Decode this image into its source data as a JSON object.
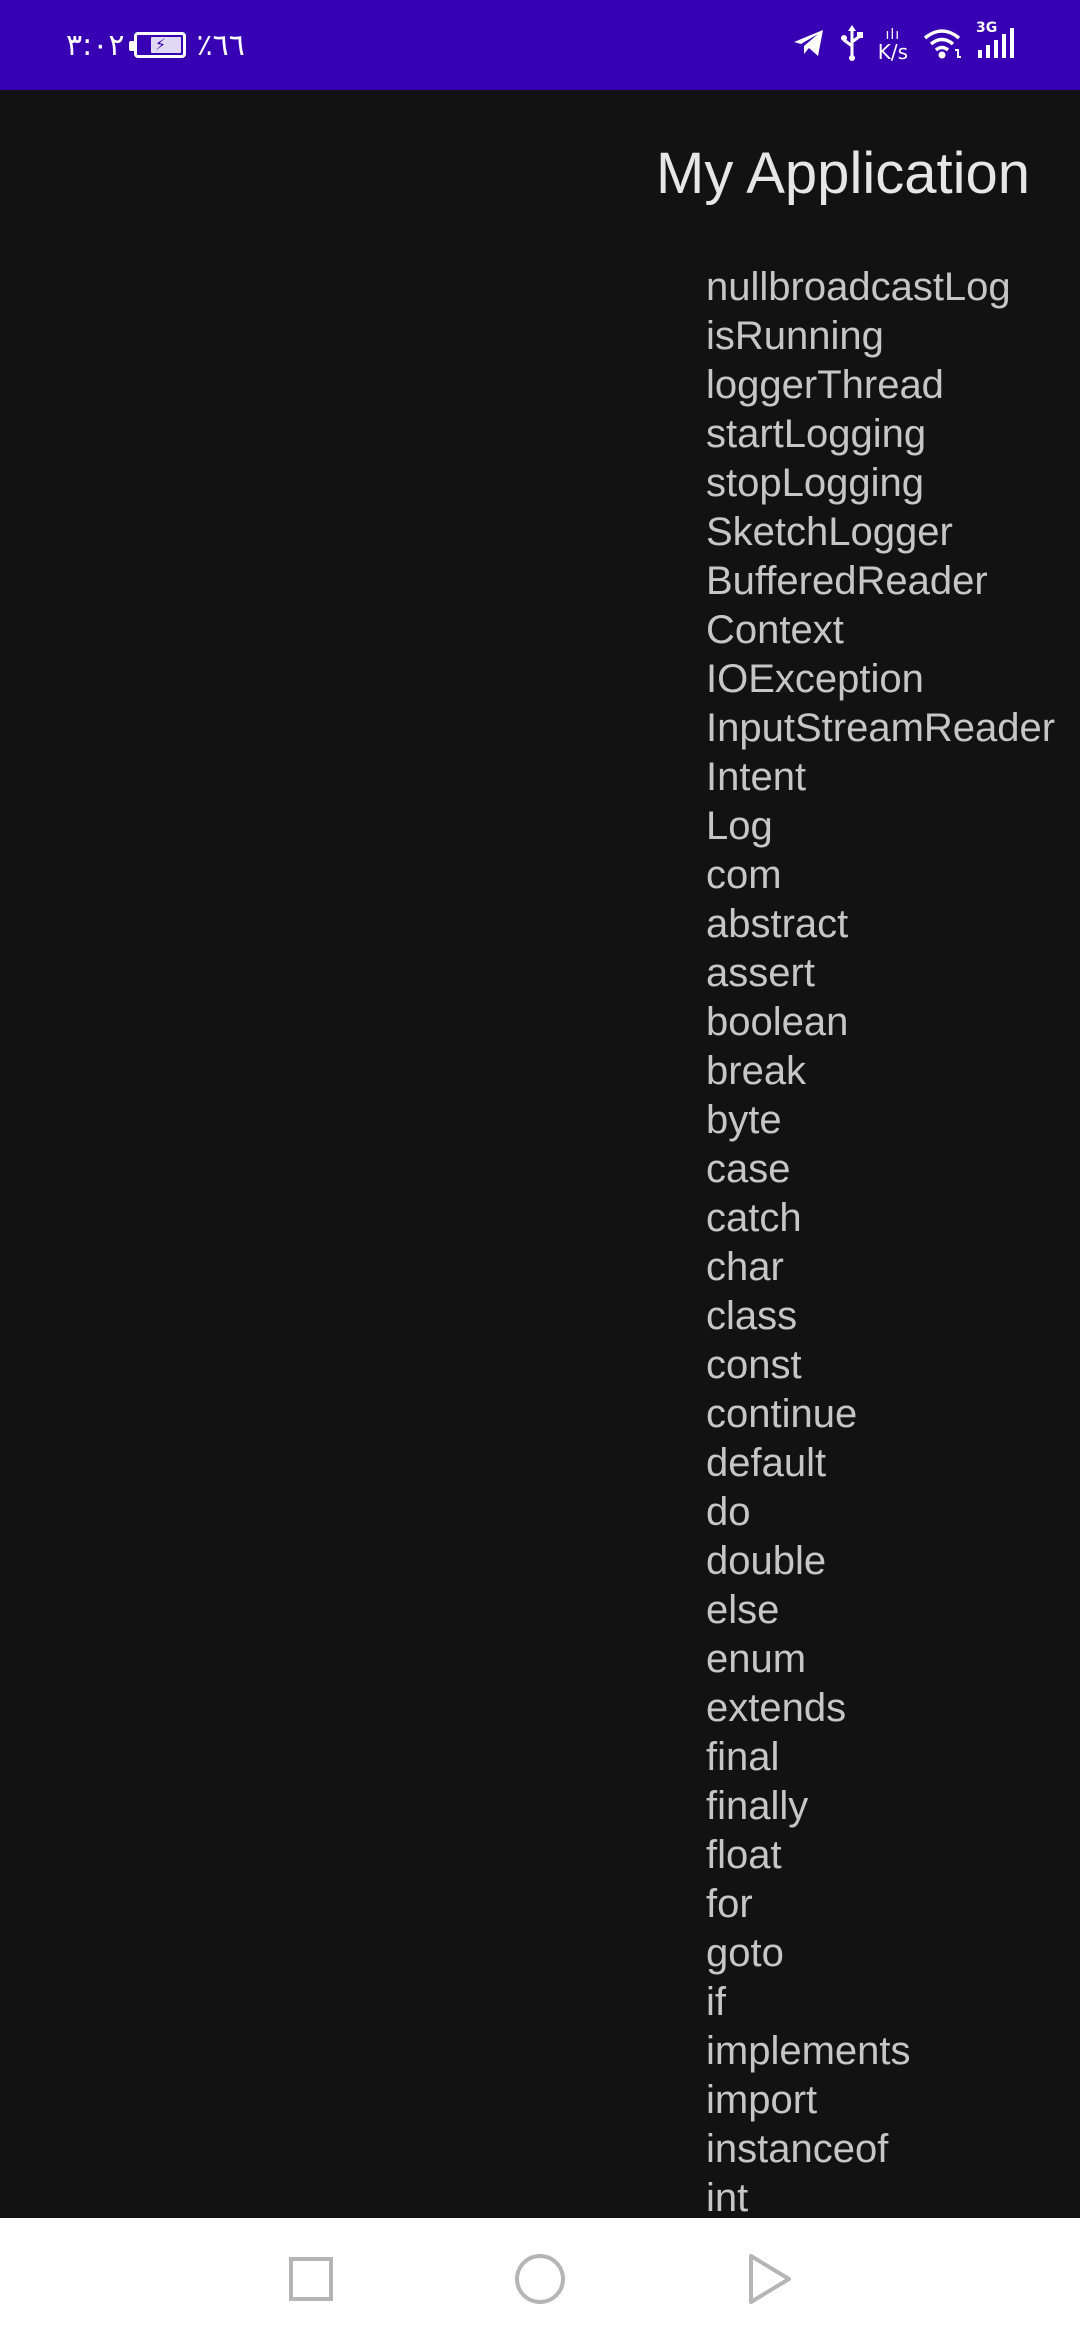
{
  "status_bar": {
    "time": "٣:٠٢",
    "battery_percent": "٪٦٦",
    "battery_level": 0.66,
    "network_speed_unit": "K/s",
    "network_type": "3G",
    "icons": [
      "telegram-icon",
      "usb-icon",
      "wifi-icon",
      "signal-icon"
    ],
    "background_color": "#3700b3"
  },
  "app": {
    "title": "My Application",
    "text_color": "#c6c6c6",
    "background_color": "#121212"
  },
  "keywords": [
    "nullbroadcastLog",
    "isRunning",
    "loggerThread",
    "startLogging",
    "stopLogging",
    "SketchLogger",
    "BufferedReader",
    "Context",
    "IOException",
    "InputStreamReader",
    "Intent",
    "Log",
    "com",
    "abstract",
    "assert",
    "boolean",
    "break",
    "byte",
    "case",
    "catch",
    "char",
    "class",
    "const",
    "continue",
    "default",
    "do",
    "double",
    "else",
    "enum",
    "extends",
    "final",
    "finally",
    "float",
    "for",
    "goto",
    "if",
    "implements",
    "import",
    "instanceof",
    "int"
  ],
  "nav_bar": {
    "buttons": [
      "recent-apps-icon",
      "home-icon",
      "back-icon"
    ]
  }
}
